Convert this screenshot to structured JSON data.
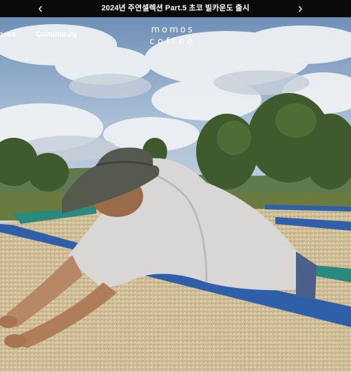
{
  "announcement": {
    "text": "2024년 주연셀렉션 Part.5 초코 빌카운도 출시",
    "prev_icon": "chevron-left-icon",
    "next_icon": "chevron-right-icon"
  },
  "nav": {
    "items": [
      {
        "label": "ness"
      },
      {
        "label": "Community"
      }
    ]
  },
  "brand": {
    "line1": "momos",
    "line2": "coffee"
  },
  "colors": {
    "announcement_bg": "#0a0a0a",
    "text": "#ffffff"
  }
}
